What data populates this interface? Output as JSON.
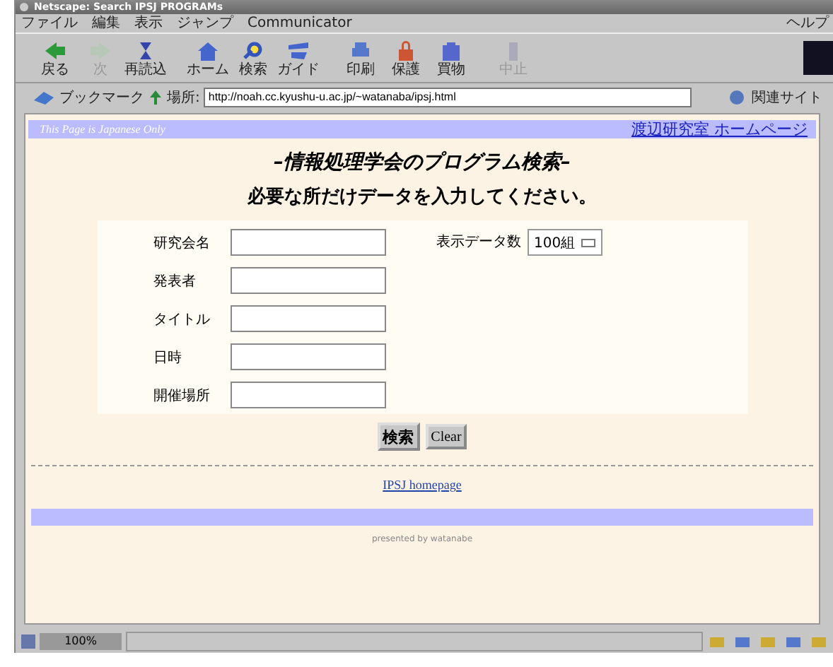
{
  "window": {
    "title": "Netscape: Search IPSJ PROGRAMs"
  },
  "menu": [
    {
      "label": "ファイル"
    },
    {
      "label": "編集"
    },
    {
      "label": "表示"
    },
    {
      "label": "ジャンプ"
    },
    {
      "label": "Communicator"
    }
  ],
  "help_menu": "ヘルプ",
  "toolbar": [
    {
      "label": "戻る",
      "kind": "back",
      "disabled": false
    },
    {
      "label": "次",
      "kind": "forward",
      "disabled": true
    },
    {
      "label": "再読込",
      "kind": "reload",
      "disabled": false
    },
    {
      "label": "ホーム",
      "kind": "home",
      "disabled": false
    },
    {
      "label": "検索",
      "kind": "search",
      "disabled": false
    },
    {
      "label": "ガイド",
      "kind": "guide",
      "disabled": false
    },
    {
      "label": "印刷",
      "kind": "print",
      "disabled": false
    },
    {
      "label": "保護",
      "kind": "lock",
      "disabled": false
    },
    {
      "label": "買物",
      "kind": "shop",
      "disabled": false
    },
    {
      "label": "中止",
      "kind": "stop",
      "disabled": true
    }
  ],
  "location_bar": {
    "bookmarks": "ブックマーク",
    "label": "場所:",
    "url": "http://noah.cc.kyushu-u.ac.jp/~watanaba/ipsj.html",
    "related": "関連サイト"
  },
  "page": {
    "banner_note": "This Page is Japanese Only",
    "home_link": "渡辺研究室 ホームページ",
    "heading": "–情報処理学会のプログラム検索–",
    "instruction": "必要な所だけデータを入力してください。",
    "fields": [
      {
        "label": "研究会名"
      },
      {
        "label": "発表者"
      },
      {
        "label": "タイトル"
      },
      {
        "label": "日時"
      },
      {
        "label": "開催場所"
      }
    ],
    "display_count": {
      "label": "表示データ数",
      "value": "100組"
    },
    "buttons": [
      {
        "label": "検索",
        "kind": "submit"
      },
      {
        "label": "Clear",
        "kind": "reset"
      }
    ],
    "footer_link": "IPSJ homepage",
    "credit": "presented by watanabe"
  },
  "status_bar": {
    "zoom": "100%"
  }
}
